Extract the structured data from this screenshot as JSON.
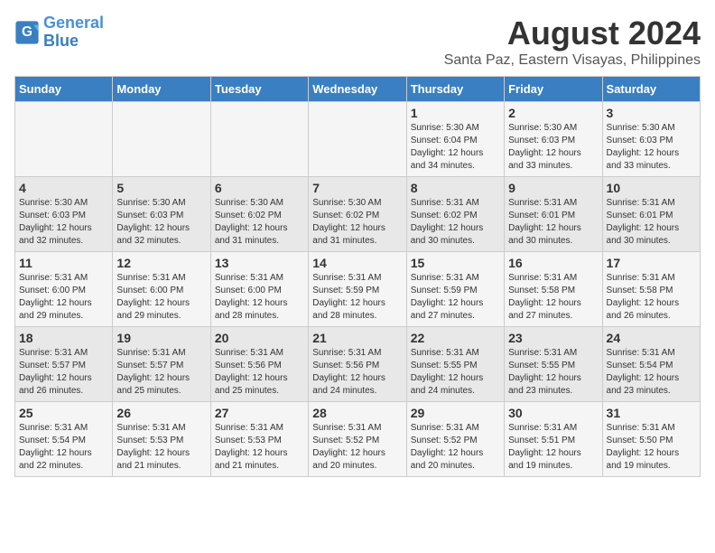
{
  "logo": {
    "line1": "General",
    "line2": "Blue"
  },
  "title": "August 2024",
  "subtitle": "Santa Paz, Eastern Visayas, Philippines",
  "days_of_week": [
    "Sunday",
    "Monday",
    "Tuesday",
    "Wednesday",
    "Thursday",
    "Friday",
    "Saturday"
  ],
  "weeks": [
    [
      {
        "day": "",
        "info": ""
      },
      {
        "day": "",
        "info": ""
      },
      {
        "day": "",
        "info": ""
      },
      {
        "day": "",
        "info": ""
      },
      {
        "day": "1",
        "info": "Sunrise: 5:30 AM\nSunset: 6:04 PM\nDaylight: 12 hours\nand 34 minutes."
      },
      {
        "day": "2",
        "info": "Sunrise: 5:30 AM\nSunset: 6:03 PM\nDaylight: 12 hours\nand 33 minutes."
      },
      {
        "day": "3",
        "info": "Sunrise: 5:30 AM\nSunset: 6:03 PM\nDaylight: 12 hours\nand 33 minutes."
      }
    ],
    [
      {
        "day": "4",
        "info": "Sunrise: 5:30 AM\nSunset: 6:03 PM\nDaylight: 12 hours\nand 32 minutes."
      },
      {
        "day": "5",
        "info": "Sunrise: 5:30 AM\nSunset: 6:03 PM\nDaylight: 12 hours\nand 32 minutes."
      },
      {
        "day": "6",
        "info": "Sunrise: 5:30 AM\nSunset: 6:02 PM\nDaylight: 12 hours\nand 31 minutes."
      },
      {
        "day": "7",
        "info": "Sunrise: 5:30 AM\nSunset: 6:02 PM\nDaylight: 12 hours\nand 31 minutes."
      },
      {
        "day": "8",
        "info": "Sunrise: 5:31 AM\nSunset: 6:02 PM\nDaylight: 12 hours\nand 30 minutes."
      },
      {
        "day": "9",
        "info": "Sunrise: 5:31 AM\nSunset: 6:01 PM\nDaylight: 12 hours\nand 30 minutes."
      },
      {
        "day": "10",
        "info": "Sunrise: 5:31 AM\nSunset: 6:01 PM\nDaylight: 12 hours\nand 30 minutes."
      }
    ],
    [
      {
        "day": "11",
        "info": "Sunrise: 5:31 AM\nSunset: 6:00 PM\nDaylight: 12 hours\nand 29 minutes."
      },
      {
        "day": "12",
        "info": "Sunrise: 5:31 AM\nSunset: 6:00 PM\nDaylight: 12 hours\nand 29 minutes."
      },
      {
        "day": "13",
        "info": "Sunrise: 5:31 AM\nSunset: 6:00 PM\nDaylight: 12 hours\nand 28 minutes."
      },
      {
        "day": "14",
        "info": "Sunrise: 5:31 AM\nSunset: 5:59 PM\nDaylight: 12 hours\nand 28 minutes."
      },
      {
        "day": "15",
        "info": "Sunrise: 5:31 AM\nSunset: 5:59 PM\nDaylight: 12 hours\nand 27 minutes."
      },
      {
        "day": "16",
        "info": "Sunrise: 5:31 AM\nSunset: 5:58 PM\nDaylight: 12 hours\nand 27 minutes."
      },
      {
        "day": "17",
        "info": "Sunrise: 5:31 AM\nSunset: 5:58 PM\nDaylight: 12 hours\nand 26 minutes."
      }
    ],
    [
      {
        "day": "18",
        "info": "Sunrise: 5:31 AM\nSunset: 5:57 PM\nDaylight: 12 hours\nand 26 minutes."
      },
      {
        "day": "19",
        "info": "Sunrise: 5:31 AM\nSunset: 5:57 PM\nDaylight: 12 hours\nand 25 minutes."
      },
      {
        "day": "20",
        "info": "Sunrise: 5:31 AM\nSunset: 5:56 PM\nDaylight: 12 hours\nand 25 minutes."
      },
      {
        "day": "21",
        "info": "Sunrise: 5:31 AM\nSunset: 5:56 PM\nDaylight: 12 hours\nand 24 minutes."
      },
      {
        "day": "22",
        "info": "Sunrise: 5:31 AM\nSunset: 5:55 PM\nDaylight: 12 hours\nand 24 minutes."
      },
      {
        "day": "23",
        "info": "Sunrise: 5:31 AM\nSunset: 5:55 PM\nDaylight: 12 hours\nand 23 minutes."
      },
      {
        "day": "24",
        "info": "Sunrise: 5:31 AM\nSunset: 5:54 PM\nDaylight: 12 hours\nand 23 minutes."
      }
    ],
    [
      {
        "day": "25",
        "info": "Sunrise: 5:31 AM\nSunset: 5:54 PM\nDaylight: 12 hours\nand 22 minutes."
      },
      {
        "day": "26",
        "info": "Sunrise: 5:31 AM\nSunset: 5:53 PM\nDaylight: 12 hours\nand 21 minutes."
      },
      {
        "day": "27",
        "info": "Sunrise: 5:31 AM\nSunset: 5:53 PM\nDaylight: 12 hours\nand 21 minutes."
      },
      {
        "day": "28",
        "info": "Sunrise: 5:31 AM\nSunset: 5:52 PM\nDaylight: 12 hours\nand 20 minutes."
      },
      {
        "day": "29",
        "info": "Sunrise: 5:31 AM\nSunset: 5:52 PM\nDaylight: 12 hours\nand 20 minutes."
      },
      {
        "day": "30",
        "info": "Sunrise: 5:31 AM\nSunset: 5:51 PM\nDaylight: 12 hours\nand 19 minutes."
      },
      {
        "day": "31",
        "info": "Sunrise: 5:31 AM\nSunset: 5:50 PM\nDaylight: 12 hours\nand 19 minutes."
      }
    ]
  ]
}
